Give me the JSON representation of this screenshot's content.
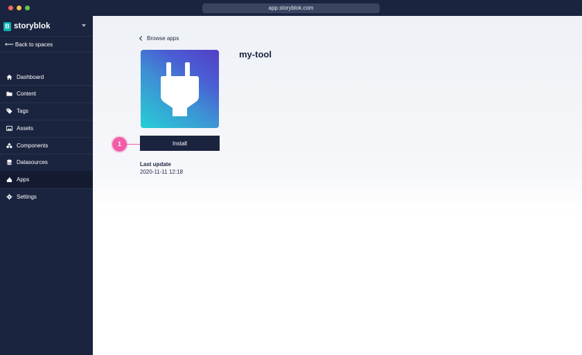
{
  "browser": {
    "url": "app.storyblok.com"
  },
  "sidebar": {
    "brand": "storyblok",
    "brand_logo_letter": "B",
    "back_label": "Back to spaces",
    "items": [
      {
        "label": "Dashboard",
        "icon": "home-icon"
      },
      {
        "label": "Content",
        "icon": "folder-icon"
      },
      {
        "label": "Tags",
        "icon": "tag-icon"
      },
      {
        "label": "Assets",
        "icon": "image-icon"
      },
      {
        "label": "Components",
        "icon": "components-icon"
      },
      {
        "label": "Datasources",
        "icon": "database-icon"
      },
      {
        "label": "Apps",
        "icon": "apps-icon",
        "active": true
      },
      {
        "label": "Settings",
        "icon": "gear-icon"
      }
    ]
  },
  "main": {
    "breadcrumb": "Browse apps",
    "app_title": "my-tool",
    "install_label": "Install",
    "step_number": "1",
    "last_update_label": "Last update",
    "last_update_value": "2020-11-11 12:18"
  },
  "colors": {
    "sidebar_bg": "#1b243f",
    "accent_pink": "#f25ca7",
    "brand_teal": "#09b3af"
  }
}
